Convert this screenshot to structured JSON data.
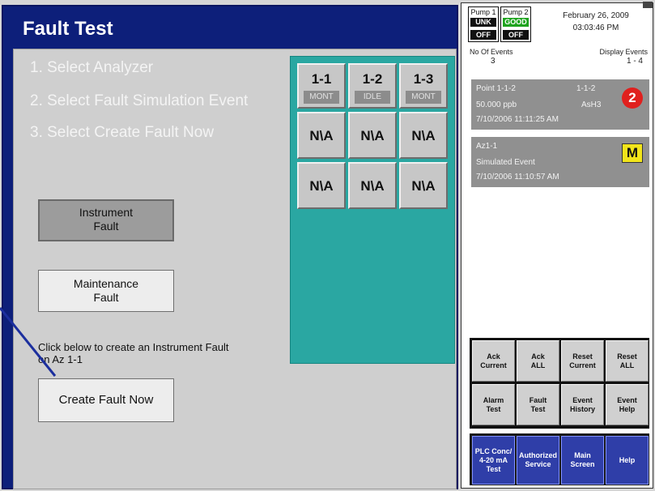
{
  "left": {
    "title": "Fault Test",
    "steps": [
      "1. Select Analyzer",
      "2. Select Fault Simulation Event",
      "3. Select Create Fault Now"
    ],
    "grid": [
      {
        "label": "1-1",
        "status": "MONT"
      },
      {
        "label": "1-2",
        "status": "IDLE"
      },
      {
        "label": "1-3",
        "status": "MONT"
      },
      {
        "label": "N\\A"
      },
      {
        "label": "N\\A"
      },
      {
        "label": "N\\A"
      },
      {
        "label": "N\\A"
      },
      {
        "label": "N\\A"
      },
      {
        "label": "N\\A"
      }
    ],
    "instrument_fault_line1": "Instrument",
    "instrument_fault_line2": "Fault",
    "maintenance_fault_line1": "Maintenance",
    "maintenance_fault_line2": "Fault",
    "hint_line1": "Click below to create an Instrument Fault",
    "hint_line2": "on Az 1-1",
    "create_fault_label": "Create Fault Now"
  },
  "right": {
    "pump1": {
      "name": "Pump 1",
      "state": "UNK",
      "mode": "OFF"
    },
    "pump2": {
      "name": "Pump 2",
      "state": "GOOD",
      "mode": "OFF"
    },
    "date": "February 26, 2009",
    "time": "03:03:46 PM",
    "events_label": "No Of Events",
    "events_count": "3",
    "display_label": "Display Events",
    "display_range": "1 - 4",
    "event1": {
      "point": "Point 1-1-2",
      "point_code": "1-1-2",
      "concentration": "50.000  ppb",
      "gas": "AsH3",
      "timestamp": "7/10/2006 11:11:25 AM",
      "badge": "2"
    },
    "event2": {
      "point": "Az1-1",
      "description": "Simulated Event",
      "timestamp": "7/10/2006 11:10:57 AM",
      "badge": "M"
    },
    "actions": [
      [
        "Ack",
        "Current"
      ],
      [
        "Ack",
        "ALL"
      ],
      [
        "Reset",
        "Current"
      ],
      [
        "Reset",
        "ALL"
      ],
      [
        "Alarm",
        "Test"
      ],
      [
        "Fault",
        "Test"
      ],
      [
        "Event",
        "History"
      ],
      [
        "Event",
        "Help"
      ]
    ],
    "nav": [
      [
        "PLC Conc/",
        "4-20 mA",
        "Test"
      ],
      [
        "Authorized",
        "Service"
      ],
      [
        "Main",
        "Screen"
      ],
      [
        "Help"
      ]
    ]
  },
  "colors": {
    "title_bar": "#0d1f7a",
    "grid_panel": "#2aa7a2",
    "pump_good": "#1ea31e",
    "alarm_badge": "#e0201e",
    "maintenance_badge": "#f2e51a",
    "nav_button": "#2f3ea8"
  }
}
